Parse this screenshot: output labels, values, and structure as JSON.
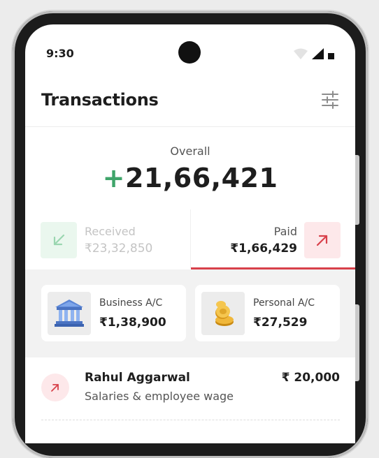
{
  "status_bar": {
    "time": "9:30"
  },
  "header": {
    "title": "Transactions",
    "filter_icon": "sliders-icon"
  },
  "overall": {
    "label": "Overall",
    "sign": "+",
    "amount": "21,66,421"
  },
  "tabs": {
    "received": {
      "label": "Received",
      "value": "₹23,32,850",
      "icon": "arrow-down-left-icon",
      "active": false
    },
    "paid": {
      "label": "Paid",
      "value": "₹1,66,429",
      "icon": "arrow-up-right-icon",
      "active": true
    }
  },
  "accounts": [
    {
      "name": "Business A/C",
      "value": "₹1,38,900",
      "icon": "bank-icon"
    },
    {
      "name": "Personal A/C",
      "value": "₹27,529",
      "icon": "coins-icon"
    }
  ],
  "transactions": [
    {
      "name": "Rahul Aggarwal",
      "description": "Salaries & employee wage",
      "amount": "₹ 20,000",
      "icon": "arrow-up-right-icon"
    }
  ],
  "colors": {
    "positive": "#3fa46a",
    "negative": "#d8404a",
    "paid_tint": "#fde8ea",
    "received_tint": "#eaf7ee"
  }
}
